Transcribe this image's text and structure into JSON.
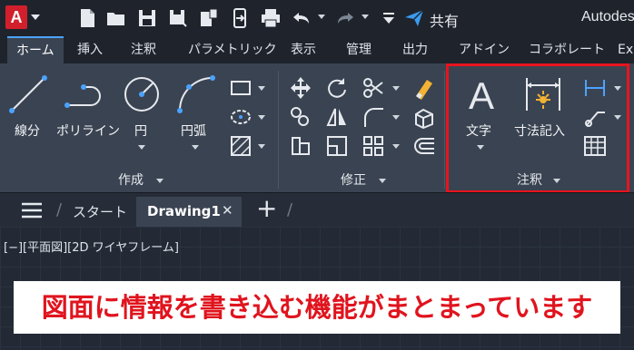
{
  "app": {
    "logo_letter": "A",
    "title": "Autodes"
  },
  "quick_access": {
    "share_label": "共有"
  },
  "tabs": [
    "ホーム",
    "挿入",
    "注釈",
    "パラメトリック",
    "表示",
    "管理",
    "出力",
    "アドイン",
    "コラボレート",
    "Ex"
  ],
  "active_tab": "ホーム",
  "ribbon": {
    "draw_panel": {
      "title": "作成",
      "tools": [
        "線分",
        "ポリライン",
        "円",
        "円弧"
      ]
    },
    "modify_panel": {
      "title": "修正"
    },
    "annotation_panel": {
      "title": "注釈",
      "tools": [
        "文字",
        "寸法記入"
      ],
      "text_icon_glyph": "A"
    }
  },
  "document_tabs": {
    "start": "スタート",
    "drawing": "Drawing1",
    "close_glyph": "✕",
    "add_glyph": "+"
  },
  "viewport": {
    "label": "[−][平面図][2D ワイヤフレーム]"
  },
  "caption": "図面に情報を書き込む機能がまとまっています",
  "colors": {
    "highlight": "#e8141e",
    "app_logo": "#d11f2c",
    "active_tab_accent": "#4ba3ff",
    "caption_text": "#e0141e"
  }
}
